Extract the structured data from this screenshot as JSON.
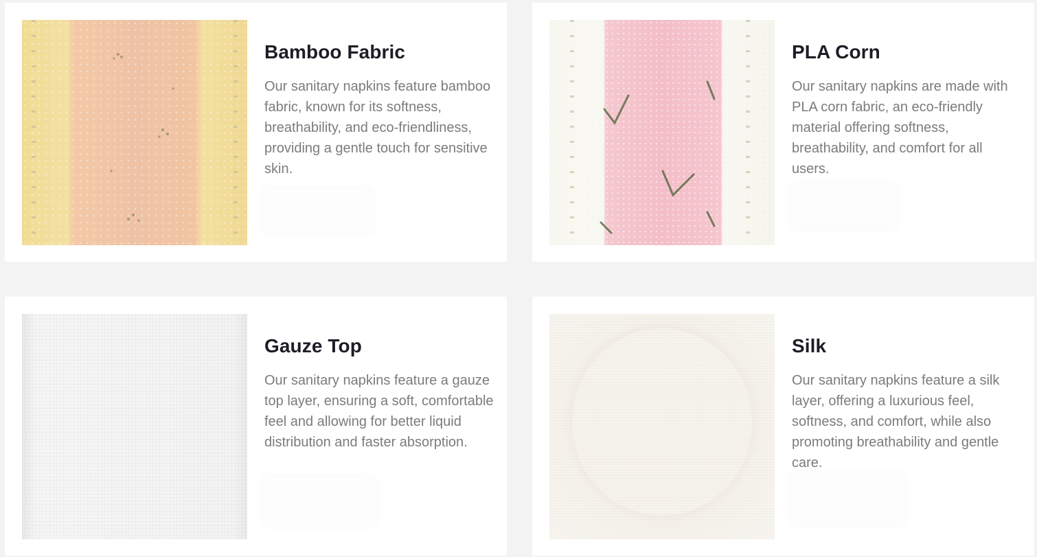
{
  "cards": [
    {
      "title": "Bamboo Fabric",
      "description": "Our sanitary napkins feature bamboo fabric, known for its softness, breathability, and eco-friendliness, providing a gentle touch for sensitive skin.",
      "image_alt": "Bamboo fabric texture"
    },
    {
      "title": "PLA Corn",
      "description": "Our sanitary napkins are made with PLA corn fabric, an eco-friendly material offering softness, breathability, and comfort for all users.",
      "image_alt": "PLA corn fabric texture"
    },
    {
      "title": "Gauze Top",
      "description": "Our sanitary napkins feature a gauze top layer, ensuring a soft, comfortable feel and allowing for better liquid distribution and faster absorption.",
      "image_alt": "Gauze top texture"
    },
    {
      "title": "Silk",
      "description": "Our sanitary napkins feature a silk layer, offering a luxurious feel, softness, and comfort, while also promoting breathability and gentle care.",
      "image_alt": "Silk texture"
    }
  ]
}
